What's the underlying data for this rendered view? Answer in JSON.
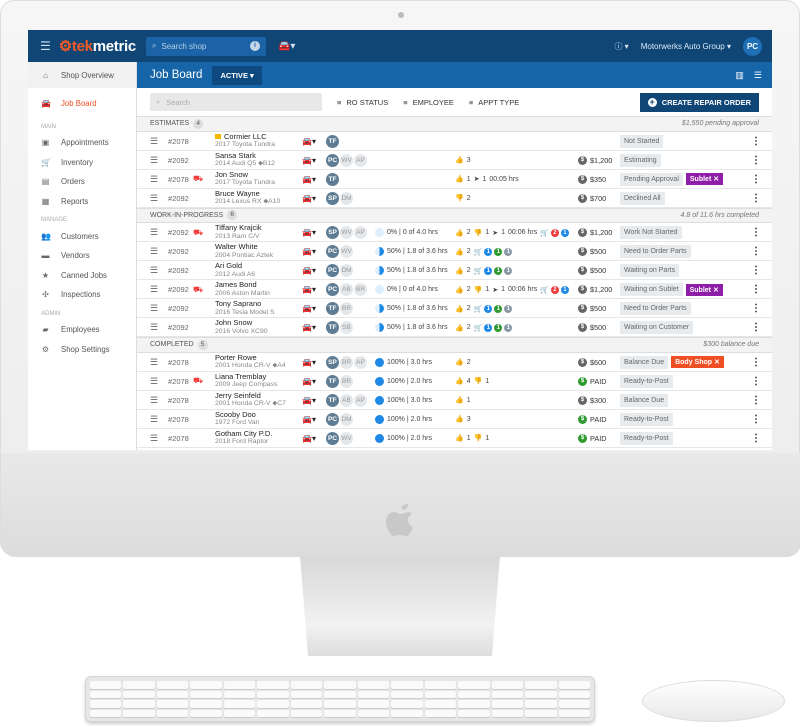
{
  "header": {
    "brand_prefix": "tek",
    "brand_suffix": "metric",
    "search_placeholder": "Search shop",
    "shop_name": "Motorwerks Auto Group",
    "user_initials": "PC"
  },
  "sidebar": {
    "top": [
      {
        "label": "Shop Overview",
        "icon": "home-icon",
        "glyph": "⌂"
      },
      {
        "label": "Job Board",
        "icon": "car-icon",
        "glyph": "🚘"
      }
    ],
    "sections": [
      {
        "title": "MAIN",
        "items": [
          {
            "label": "Appointments",
            "icon": "calendar-icon",
            "glyph": "▣"
          },
          {
            "label": "Inventory",
            "icon": "cart-icon",
            "glyph": "🛒"
          },
          {
            "label": "Orders",
            "icon": "orders-icon",
            "glyph": "▤"
          },
          {
            "label": "Reports",
            "icon": "reports-icon",
            "glyph": "▦"
          }
        ]
      },
      {
        "title": "MANAGE",
        "items": [
          {
            "label": "Customers",
            "icon": "people-icon",
            "glyph": "👥"
          },
          {
            "label": "Vendors",
            "icon": "store-icon",
            "glyph": "▬"
          },
          {
            "label": "Canned Jobs",
            "icon": "star-icon",
            "glyph": "★"
          },
          {
            "label": "Inspections",
            "icon": "inspections-icon",
            "glyph": "✣"
          }
        ]
      },
      {
        "title": "ADMIN",
        "items": [
          {
            "label": "Employees",
            "icon": "employees-icon",
            "glyph": "▰"
          },
          {
            "label": "Shop Settings",
            "icon": "gear-icon",
            "glyph": "⚙"
          }
        ]
      }
    ]
  },
  "page": {
    "title": "Job Board",
    "filter": "ACTIVE",
    "search_placeholder": "Search",
    "filters": [
      "RO STATUS",
      "EMPLOYEE",
      "APPT TYPE"
    ],
    "create_label": "CREATE REPAIR ORDER"
  },
  "colors": {
    "brand": "#f25b26",
    "topbar": "#0f4676",
    "subheader": "#1565a8",
    "sublet": "#8e1ea8",
    "body_shop": "#f04e23"
  },
  "groups": [
    {
      "title": "ESTIMATES",
      "count": "4",
      "summary": "$1,550 pending approval",
      "rows": [
        {
          "ro": "#2078",
          "flag": true,
          "name": "Cormier LLC",
          "vehicle": "2017 Toyota Tundra",
          "techs": [
            [
              "TF",
              1
            ]
          ],
          "status": "Not Started"
        },
        {
          "ro": "#2092",
          "name": "Sansa Stark",
          "vehicle": "2014 Audi Q5",
          "label": "B12",
          "techs": [
            [
              "PC",
              1
            ],
            [
              "WV",
              0
            ],
            [
              "AP",
              0
            ]
          ],
          "pending": "3",
          "amount": "$1,200",
          "status": "Estimating"
        },
        {
          "ro": "#2078",
          "alert": true,
          "name": "Jon Snow",
          "vehicle": "2017 Toyota Tundra",
          "techs": [
            [
              "TF",
              1
            ]
          ],
          "pending": "1",
          "sent": "1",
          "time": "00:05 hrs",
          "amount": "$350",
          "status": "Pending Approval",
          "tag": "Sublet",
          "tagColor": "#8e1ea8"
        },
        {
          "ro": "#2092",
          "name": "Bruce Wayne",
          "vehicle": "2014 Lexus RX",
          "label": "A10",
          "techs": [
            [
              "SP",
              1
            ],
            [
              "DM",
              0
            ]
          ],
          "down": "2",
          "amount": "$700",
          "status": "Declined All"
        }
      ]
    },
    {
      "title": "WORK-IN-PROGRESS",
      "count": "6",
      "summary": "4.8 of 11.6 hrs completed",
      "rows": [
        {
          "ro": "#2092",
          "alert": true,
          "name": "Tiffany Krajcik",
          "vehicle": "2013 Ram C/V",
          "techs": [
            [
              "SP",
              1
            ],
            [
              "WV",
              0
            ],
            [
              "AP",
              0
            ]
          ],
          "pct": 0,
          "progress": "0% | 0 of 4.0 hrs",
          "up": "2",
          "down": "1",
          "sent": "1",
          "time": "00:06 hrs",
          "parts": [
            [
              "2",
              "#f03a3a"
            ],
            [
              "1",
              "#1e88e5"
            ]
          ],
          "amount": "$1,200",
          "status": "Work Not Started"
        },
        {
          "ro": "#2092",
          "name": "Walter White",
          "vehicle": "2004 Pontiac Aztek",
          "techs": [
            [
              "PC",
              1
            ],
            [
              "WV",
              0
            ]
          ],
          "pct": 50,
          "progress": "50% | 1.8 of 3.6 hrs",
          "up": "2",
          "parts": [
            [
              "1",
              "#1e88e5"
            ],
            [
              "1",
              "#2f9a2f"
            ],
            [
              "1",
              "#8a99a6"
            ]
          ],
          "amount": "$500",
          "status": "Need to Order Parts"
        },
        {
          "ro": "#2092",
          "name": "Ari Gold",
          "vehicle": "2012 Audi A6",
          "techs": [
            [
              "PC",
              1
            ],
            [
              "DM",
              0
            ]
          ],
          "pct": 50,
          "progress": "50% | 1.8 of 3.6 hrs",
          "up": "2",
          "parts": [
            [
              "1",
              "#1e88e5"
            ],
            [
              "1",
              "#2f9a2f"
            ],
            [
              "1",
              "#8a99a6"
            ]
          ],
          "amount": "$500",
          "status": "Waiting on Parts"
        },
        {
          "ro": "#2092",
          "alert": true,
          "name": "James Bond",
          "vehicle": "2006 Aston Martin",
          "techs": [
            [
              "PC",
              1
            ],
            [
              "AB",
              0
            ],
            [
              "BR",
              0
            ]
          ],
          "pct": 0,
          "progress": "0% | 0 of 4.0 hrs",
          "up": "2",
          "down": "1",
          "sent": "1",
          "time": "00:06 hrs",
          "parts": [
            [
              "2",
              "#f03a3a"
            ],
            [
              "1",
              "#1e88e5"
            ]
          ],
          "amount": "$1,200",
          "status": "Waiting on Sublet",
          "tag": "Sublet",
          "tagColor": "#8e1ea8"
        },
        {
          "ro": "#2092",
          "name": "Tony Saprano",
          "vehicle": "2016 Tesla Model S",
          "techs": [
            [
              "TF",
              1
            ],
            [
              "BR",
              0
            ]
          ],
          "pct": 50,
          "progress": "50% | 1.8 of 3.6 hrs",
          "up": "2",
          "parts": [
            [
              "1",
              "#1e88e5"
            ],
            [
              "1",
              "#2f9a2f"
            ],
            [
              "1",
              "#8a99a6"
            ]
          ],
          "amount": "$500",
          "status": "Need to Order Parts"
        },
        {
          "ro": "#2092",
          "name": "John Snow",
          "vehicle": "2016 Volvo XC90",
          "techs": [
            [
              "TF",
              1
            ],
            [
              "SB",
              0
            ]
          ],
          "pct": 50,
          "progress": "50% | 1.8 of 3.6 hrs",
          "up": "2",
          "parts": [
            [
              "1",
              "#1e88e5"
            ],
            [
              "1",
              "#2f9a2f"
            ],
            [
              "1",
              "#8a99a6"
            ]
          ],
          "amount": "$500",
          "status": "Waiting on Customer"
        }
      ]
    },
    {
      "title": "COMPLETED",
      "count": "5",
      "summary": "$300 balance due",
      "rows": [
        {
          "ro": "#2078",
          "name": "Porter Rowe",
          "vehicle": "2001 Honda CR-V",
          "label": "A4",
          "techs": [
            [
              "SP",
              1
            ],
            [
              "BR",
              0
            ],
            [
              "AP",
              0
            ]
          ],
          "pct": 100,
          "progress": "100% | 3.0 hrs",
          "up": "2",
          "amount": "$600",
          "status": "Balance Due",
          "tag": "Body Shop",
          "tagColor": "#f04e23"
        },
        {
          "ro": "#2078",
          "alert": true,
          "name": "Liana Tremblay",
          "vehicle": "2009 Jeep Compass",
          "techs": [
            [
              "TF",
              1
            ],
            [
              "BR",
              0
            ]
          ],
          "pct": 100,
          "progress": "100% | 2.0 hrs",
          "up": "4",
          "down": "1",
          "amount": "PAID",
          "paid": true,
          "status": "Ready-to-Post"
        },
        {
          "ro": "#2078",
          "name": "Jerry Seinfeld",
          "vehicle": "2001 Honda CR-V",
          "label": "C7",
          "techs": [
            [
              "TF",
              1
            ],
            [
              "AB",
              0
            ],
            [
              "AP",
              0
            ]
          ],
          "pct": 100,
          "progress": "100% | 3.0 hrs",
          "up": "1",
          "amount": "$300",
          "status": "Balance Due"
        },
        {
          "ro": "#2078",
          "name": "Scooby Doo",
          "vehicle": "1972 Ford Van",
          "techs": [
            [
              "PC",
              1
            ],
            [
              "DM",
              0
            ]
          ],
          "pct": 100,
          "progress": "100% | 2.0 hrs",
          "up": "3",
          "amount": "PAID",
          "paid": true,
          "status": "Ready-to-Post"
        },
        {
          "ro": "#2078",
          "name": "Gotham City P.D.",
          "vehicle": "2018 Ford Raptor",
          "techs": [
            [
              "PC",
              1
            ],
            [
              "WV",
              0
            ]
          ],
          "pct": 100,
          "progress": "100% | 2.0 hrs",
          "up": "1",
          "down": "1",
          "amount": "PAID",
          "paid": true,
          "status": "Ready-to-Post"
        }
      ]
    }
  ]
}
